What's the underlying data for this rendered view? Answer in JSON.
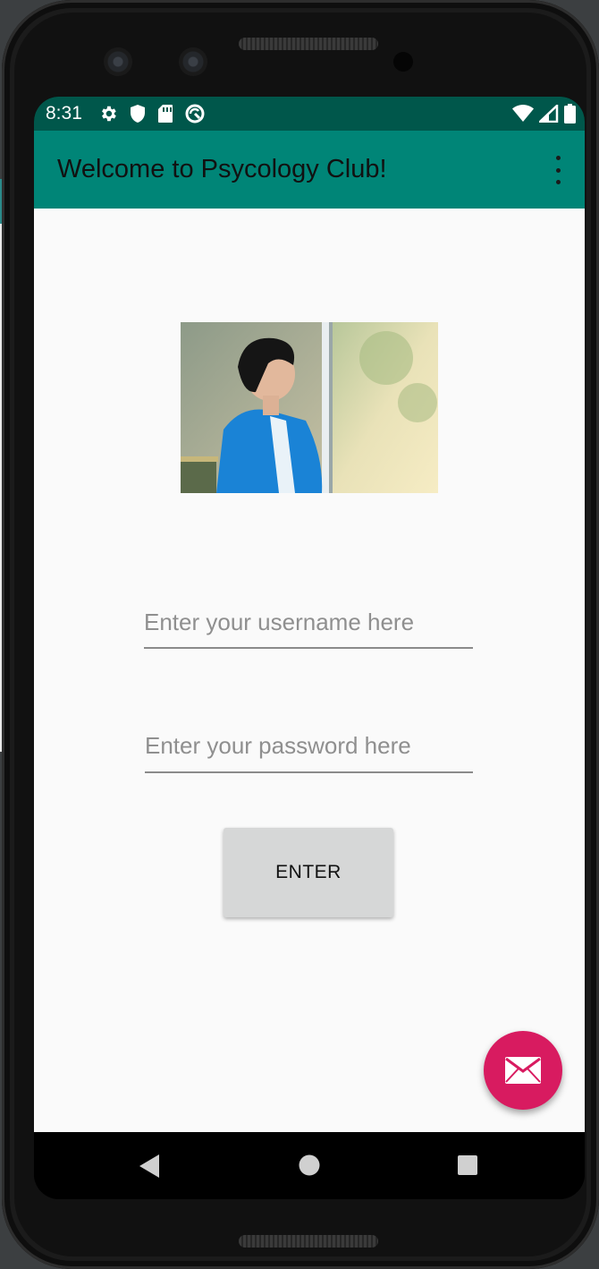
{
  "status_bar": {
    "time": "8:31",
    "left_icons": [
      "settings-icon",
      "shield-icon",
      "sd-card-icon",
      "sync-icon"
    ],
    "right_icons": [
      "wifi-icon",
      "cell-signal-icon",
      "battery-icon"
    ]
  },
  "app_bar": {
    "title": "Welcome to Psycology Club!",
    "menu_icon": "more-vert-icon"
  },
  "form": {
    "username_placeholder": "Enter your username here",
    "password_placeholder": "Enter your password here",
    "enter_label": "ENTER"
  },
  "fab": {
    "icon": "email-icon"
  },
  "nav_bar": {
    "buttons": [
      "back-icon",
      "home-icon",
      "recents-icon"
    ]
  },
  "colors": {
    "status_bar": "#00574b",
    "app_bar": "#008577",
    "fab": "#d81b60",
    "button": "#d6d7d7",
    "background": "#fafafa"
  }
}
